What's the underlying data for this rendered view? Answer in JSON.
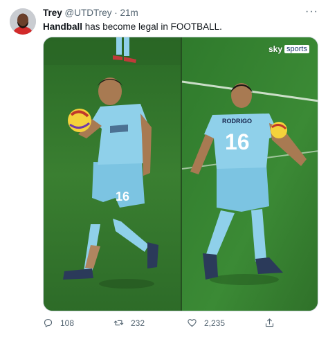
{
  "tweet": {
    "author_name": "Trey",
    "author_handle": "@UTDTrey",
    "separator": "·",
    "timestamp": "21m",
    "more_glyph": "···",
    "text_bold": "Handball",
    "text_rest": " has become legal in FOOTBALL.",
    "media": {
      "watermark_brand": "sky",
      "watermark_channel": "sports",
      "left_shirt_number": "16",
      "right_shirt_name": "RODRIGO",
      "right_shirt_number": "16",
      "jersey_color": "#8fd0ea",
      "pitch_color": "#2f6a2a"
    },
    "actions": {
      "replies": "108",
      "retweets": "232",
      "likes": "2,235"
    }
  }
}
